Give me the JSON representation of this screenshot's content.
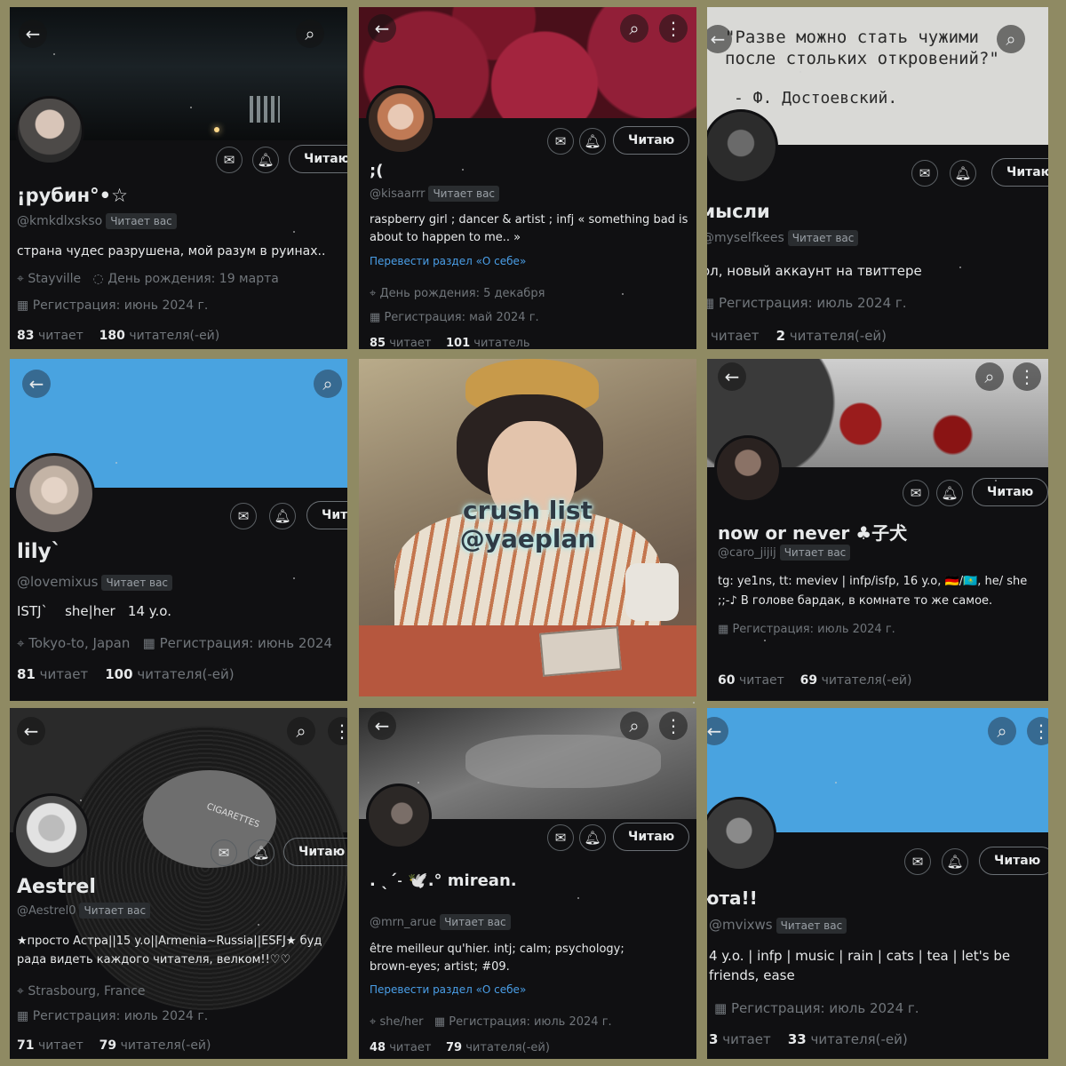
{
  "ui": {
    "back_glyph": "←",
    "search_glyph": "⌕",
    "more_glyph": "⋮",
    "mail_glyph": "✉",
    "bell_glyph": "🔔︎",
    "location_glyph": "⌖",
    "calendar_glyph": "▦",
    "balloon_glyph": "◌",
    "follows_you": "Читает вас",
    "following_label": "Читаю",
    "translate_label": "Перевести раздел «О себе»"
  },
  "center": {
    "line1": "crush list",
    "line2": "@yaeplan"
  },
  "profiles": [
    {
      "name": "¡рубин°•☆",
      "handle": "@kmkdlxskso",
      "bio": "страна чудес разрушена, мой разум в руинах..",
      "location": "Stayville",
      "birthday": "День рождения: 19 марта",
      "joined": "Регистрация: июнь 2024 г.",
      "following_count": "83",
      "following_label": "читает",
      "followers_count": "180",
      "followers_label": "читателя(-ей)"
    },
    {
      "name": ";(",
      "handle": "@kisaarrr",
      "bio": "raspberry girl ; dancer & artist ; infj « something bad is about to happen to me.. »",
      "birthday": "День рождения: 5 декабря",
      "joined": "Регистрация: май 2024 г.",
      "following_count": "85",
      "following_label": "читает",
      "followers_count": "101",
      "followers_label": "читатель"
    },
    {
      "quote": "\"Разве можно стать чужими после стольких откровений?\"",
      "quote_author": "- Ф. Достоевский.",
      "name": "мысли",
      "handle": "@myselfkees",
      "bio": "ол, новый аккаунт на твиттере",
      "joined": "Регистрация: июль 2024 г.",
      "following_count": "",
      "following_label": "читает",
      "followers_count": "2",
      "followers_label": "читателя(-ей)"
    },
    {
      "name": "lily`",
      "handle": "@lovemixus",
      "bio": "ISTJ`    she|her   14 y.o.",
      "location": "Tokyo-to, Japan",
      "joined": "Регистрация: июнь 2024",
      "following_count": "81",
      "following_label": "читает",
      "followers_count": "100",
      "followers_label": "читателя(-ей)",
      "button_label": "Чит"
    },
    {
      "name": "now or never ♣子犬",
      "handle": "@caro_jijij",
      "bio": "tg: ye1ns, tt: meviev  | infp/isfp, 16 y.o, 🇩🇪/🇰🇿, he/ she ;;-♪ В голове бардак, в комнате то же самое.",
      "joined": "Регистрация: июль 2024 г.",
      "following_count": "60",
      "following_label": "читает",
      "followers_count": "69",
      "followers_label": "читателя(-ей)"
    },
    {
      "name": "Aestrel",
      "handle": "@Aestrel0",
      "bio": "★просто Астра||15  y.o||Armenia~Russia||ESFJ★  буд рада видеть каждого читателя, велком!!♡♡",
      "location": "Strasbourg, France",
      "joined": "Регистрация: июль 2024 г.",
      "following_count": "71",
      "following_label": "читает",
      "followers_count": "79",
      "followers_label": "читателя(-ей)",
      "record_text": "CIGARETTES"
    },
    {
      "name": ". ˎˊ˗ 🕊️.° mirean.",
      "handle": "@mrn_arue",
      "bio": "être meilleur qu'hier. intj; calm; psychology; brown-eyes; artist; #09.",
      "pronouns": "she/her",
      "joined": "Регистрация: июль 2024 г.",
      "following_count": "48",
      "following_label": "читает",
      "followers_count": "79",
      "followers_label": "читателя(-ей)"
    },
    {
      "name": "юта!!",
      "handle": "@mvixws",
      "bio": "4 y.o. | infp | music | rain | cats | tea | let's be friends, ease",
      "joined": "Регистрация: июль 2024 г.",
      "following_count": "3",
      "following_label": "читает",
      "followers_count": "33",
      "followers_label": "читателя(-ей)"
    }
  ],
  "colors": {
    "collage_bg": "#8f8a63",
    "tile_bg": "#101012",
    "text": "#e7e9ea",
    "muted": "#71767b",
    "link": "#4a9fe8",
    "sky_banner": "#49a3e0",
    "overlay_glow": "#a8e3e4"
  }
}
